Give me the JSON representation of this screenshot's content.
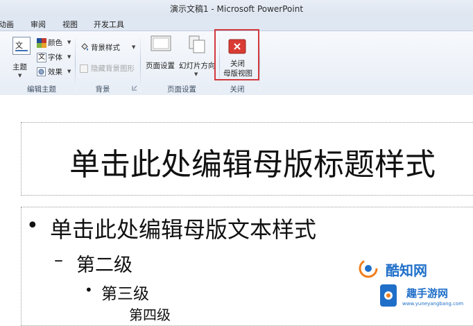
{
  "window": {
    "title": "演示文稿1 - Microsoft PowerPoint"
  },
  "tabs": [
    "动画",
    "审阅",
    "视图",
    "开发工具"
  ],
  "ribbon": {
    "edit_theme": {
      "theme_label": "主题",
      "colors_label": "颜色",
      "fonts_label": "字体",
      "effects_label": "效果",
      "group_label": "编辑主题"
    },
    "background": {
      "styles_label": "背景样式",
      "hide_bg_label": "隐藏背景图形",
      "group_label": "背景"
    },
    "page_setup": {
      "page_setup_label": "页面设置",
      "orientation_label": "幻灯片方向",
      "group_label": "页面设置"
    },
    "close": {
      "close_label_line1": "关闭",
      "close_label_line2": "母版视图",
      "group_label": "关闭"
    }
  },
  "slide": {
    "title_placeholder": "单击此处编辑母版标题样式",
    "body": {
      "level1": "单击此处编辑母版文本样式",
      "level2": "第二级",
      "level3": "第三级",
      "level4": "第四级"
    }
  },
  "watermark": {
    "brand": "酷知网",
    "site_cn": "趣手游网",
    "site_url": "www.yuneyangbang.com"
  },
  "colors": {
    "highlight_border": "#d2393d",
    "close_icon_red": "#d93b33",
    "watermark_blue": "#1f6fc9",
    "watermark_orange": "#f07d19"
  }
}
